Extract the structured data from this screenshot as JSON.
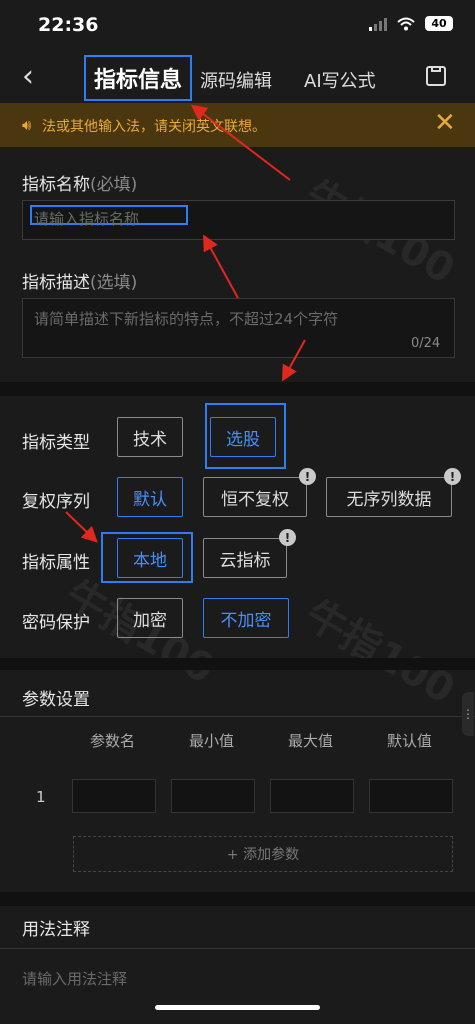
{
  "status": {
    "time": "22:36",
    "battery": "40"
  },
  "header": {
    "tab_active": "指标信息",
    "tab_source": "源码编辑",
    "tab_ai": "AI写公式"
  },
  "warning": {
    "text": "法或其他输入法，请关闭英文联想。"
  },
  "name_field": {
    "label": "指标名称",
    "hint": "(必填)",
    "placeholder": "请输入指标名称"
  },
  "desc_field": {
    "label": "指标描述",
    "hint": "(选填)",
    "placeholder": "请简单描述下新指标的特点，不超过24个字符",
    "counter": "0/24"
  },
  "options": {
    "type": {
      "label": "指标类型",
      "items": [
        "技术",
        "选股"
      ],
      "selected": "选股"
    },
    "restore": {
      "label": "复权序列",
      "items": [
        "默认",
        "恒不复权",
        "无序列数据"
      ],
      "selected": "默认"
    },
    "attr": {
      "label": "指标属性",
      "items": [
        "本地",
        "云指标"
      ],
      "selected": "本地"
    },
    "password": {
      "label": "密码保护",
      "items": [
        "加密",
        "不加密"
      ],
      "selected": "不加密"
    }
  },
  "params": {
    "title": "参数设置",
    "columns": [
      "参数名",
      "最小值",
      "最大值",
      "默认值"
    ],
    "rows": [
      {
        "index": "1"
      }
    ],
    "add_label": "+ 添加参数"
  },
  "usage": {
    "title": "用法注释",
    "placeholder": "请输入用法注释"
  },
  "watermark": "牛指100",
  "colors": {
    "accent": "#2f7df6",
    "warning_text": "#e9a93a",
    "warning_bg": "#4a3710",
    "annotation": "#e0281f"
  }
}
